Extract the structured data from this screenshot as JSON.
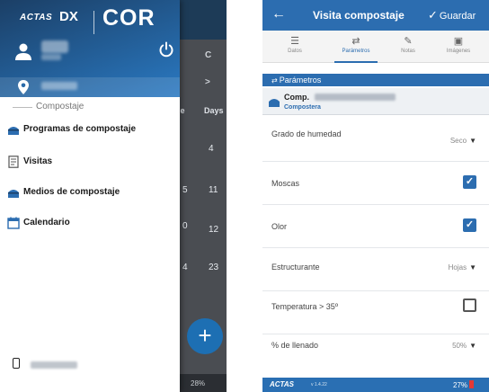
{
  "left_screen": {
    "background": {
      "rows": [
        "C",
        ">"
      ],
      "columns": [
        "de",
        "Days"
      ],
      "left_numbers": [
        "5",
        "0",
        "4"
      ],
      "right_numbers": [
        "4",
        "11",
        "12",
        "23"
      ],
      "fab_label": "+",
      "status_text": "28%"
    },
    "drawer": {
      "logo_actas": "ACTAS",
      "logo_dx": "DX",
      "logo_cor": "COR",
      "section_label": "Compostaje",
      "items": [
        {
          "label": "Programas de compostaje",
          "icon": "compost-bin-icon"
        },
        {
          "label": "Visitas",
          "icon": "document-icon"
        },
        {
          "label": "Medios de compostaje",
          "icon": "compost-bin-icon"
        },
        {
          "label": "Calendario",
          "icon": "calendar-icon"
        }
      ]
    }
  },
  "right_screen": {
    "header": {
      "title": "Visita compostaje",
      "save_label": "Guardar"
    },
    "tabs": [
      {
        "label": "Datos",
        "icon": "☰"
      },
      {
        "label": "Parámetros",
        "icon": "⇄",
        "active": true
      },
      {
        "label": "Notas",
        "icon": "✎"
      },
      {
        "label": "Imágenes",
        "icon": "▣"
      }
    ],
    "section_title": "Parámetros",
    "comp": {
      "name_prefix": "Comp.",
      "subtitle": "Compostera"
    },
    "params": [
      {
        "label": "Grado de humedad",
        "type": "select",
        "value": "Seco"
      },
      {
        "label": "Moscas",
        "type": "checkbox",
        "checked": true
      },
      {
        "label": "Olor",
        "type": "checkbox",
        "checked": true
      },
      {
        "label": "Estructurante",
        "type": "select",
        "value": "Hojas"
      },
      {
        "label": "Temperatura > 35º",
        "type": "checkbox",
        "checked": false
      },
      {
        "label": "% de llenado",
        "type": "select",
        "value": "50%"
      }
    ],
    "status": {
      "brand": "ACTAS",
      "version": "v 1.4.22",
      "battery": "27%"
    }
  },
  "colors": {
    "primary": "#2c6db0",
    "header_dark": "#1b3f66",
    "battery_low": "#e53935"
  }
}
